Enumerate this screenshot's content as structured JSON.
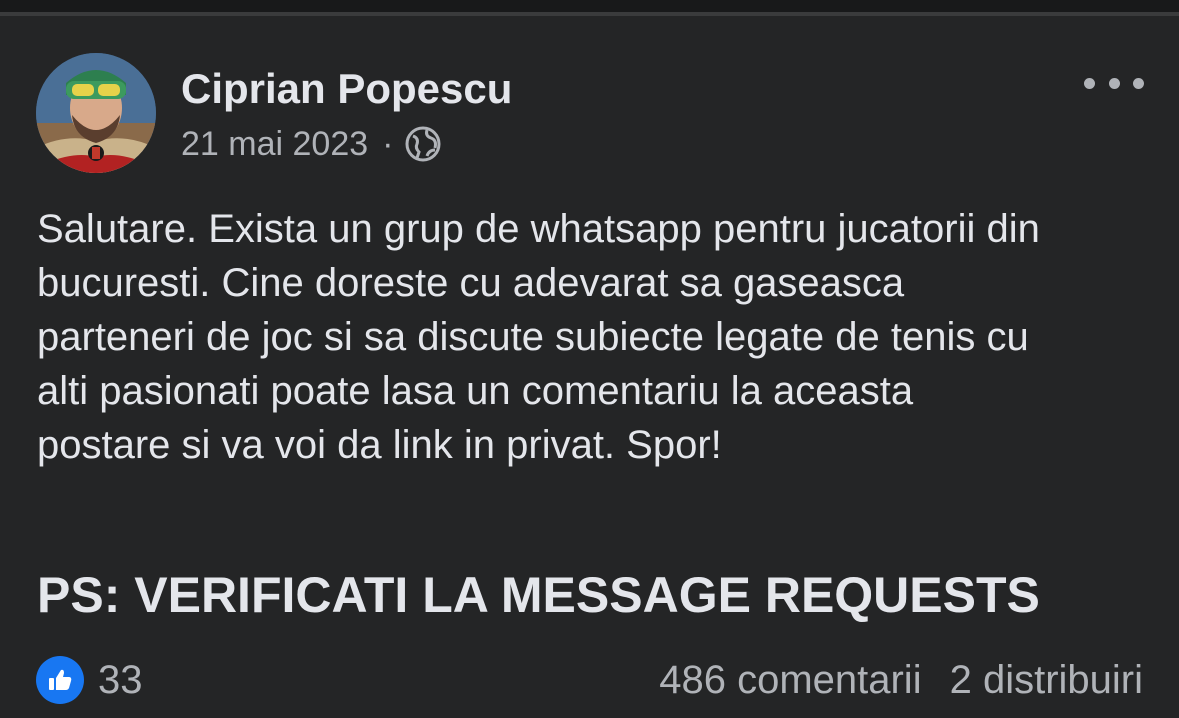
{
  "post": {
    "author": "Ciprian Popescu",
    "date": "21 mai 2023",
    "separator": "·",
    "privacy_icon": "globe-icon",
    "body": "Salutare. Exista un grup de whatsapp pentru jucatorii din\nbucuresti. Cine doreste cu adevarat sa gaseasca\nparteneri de joc si sa discute subiecte legate de tenis cu\nalti pasionati poate lasa un comentariu la aceasta\npostare si va voi da link in privat. Spor!",
    "ps": "PS: VERIFICATI LA MESSAGE REQUESTS",
    "reactions": {
      "icon": "like-icon",
      "count": "33"
    },
    "comments": "486 comentarii",
    "shares": "2 distribuiri"
  },
  "colors": {
    "background": "#242526",
    "text_primary": "#e4e6eb",
    "text_secondary": "#b0b3b8",
    "like_blue": "#1877f2"
  }
}
